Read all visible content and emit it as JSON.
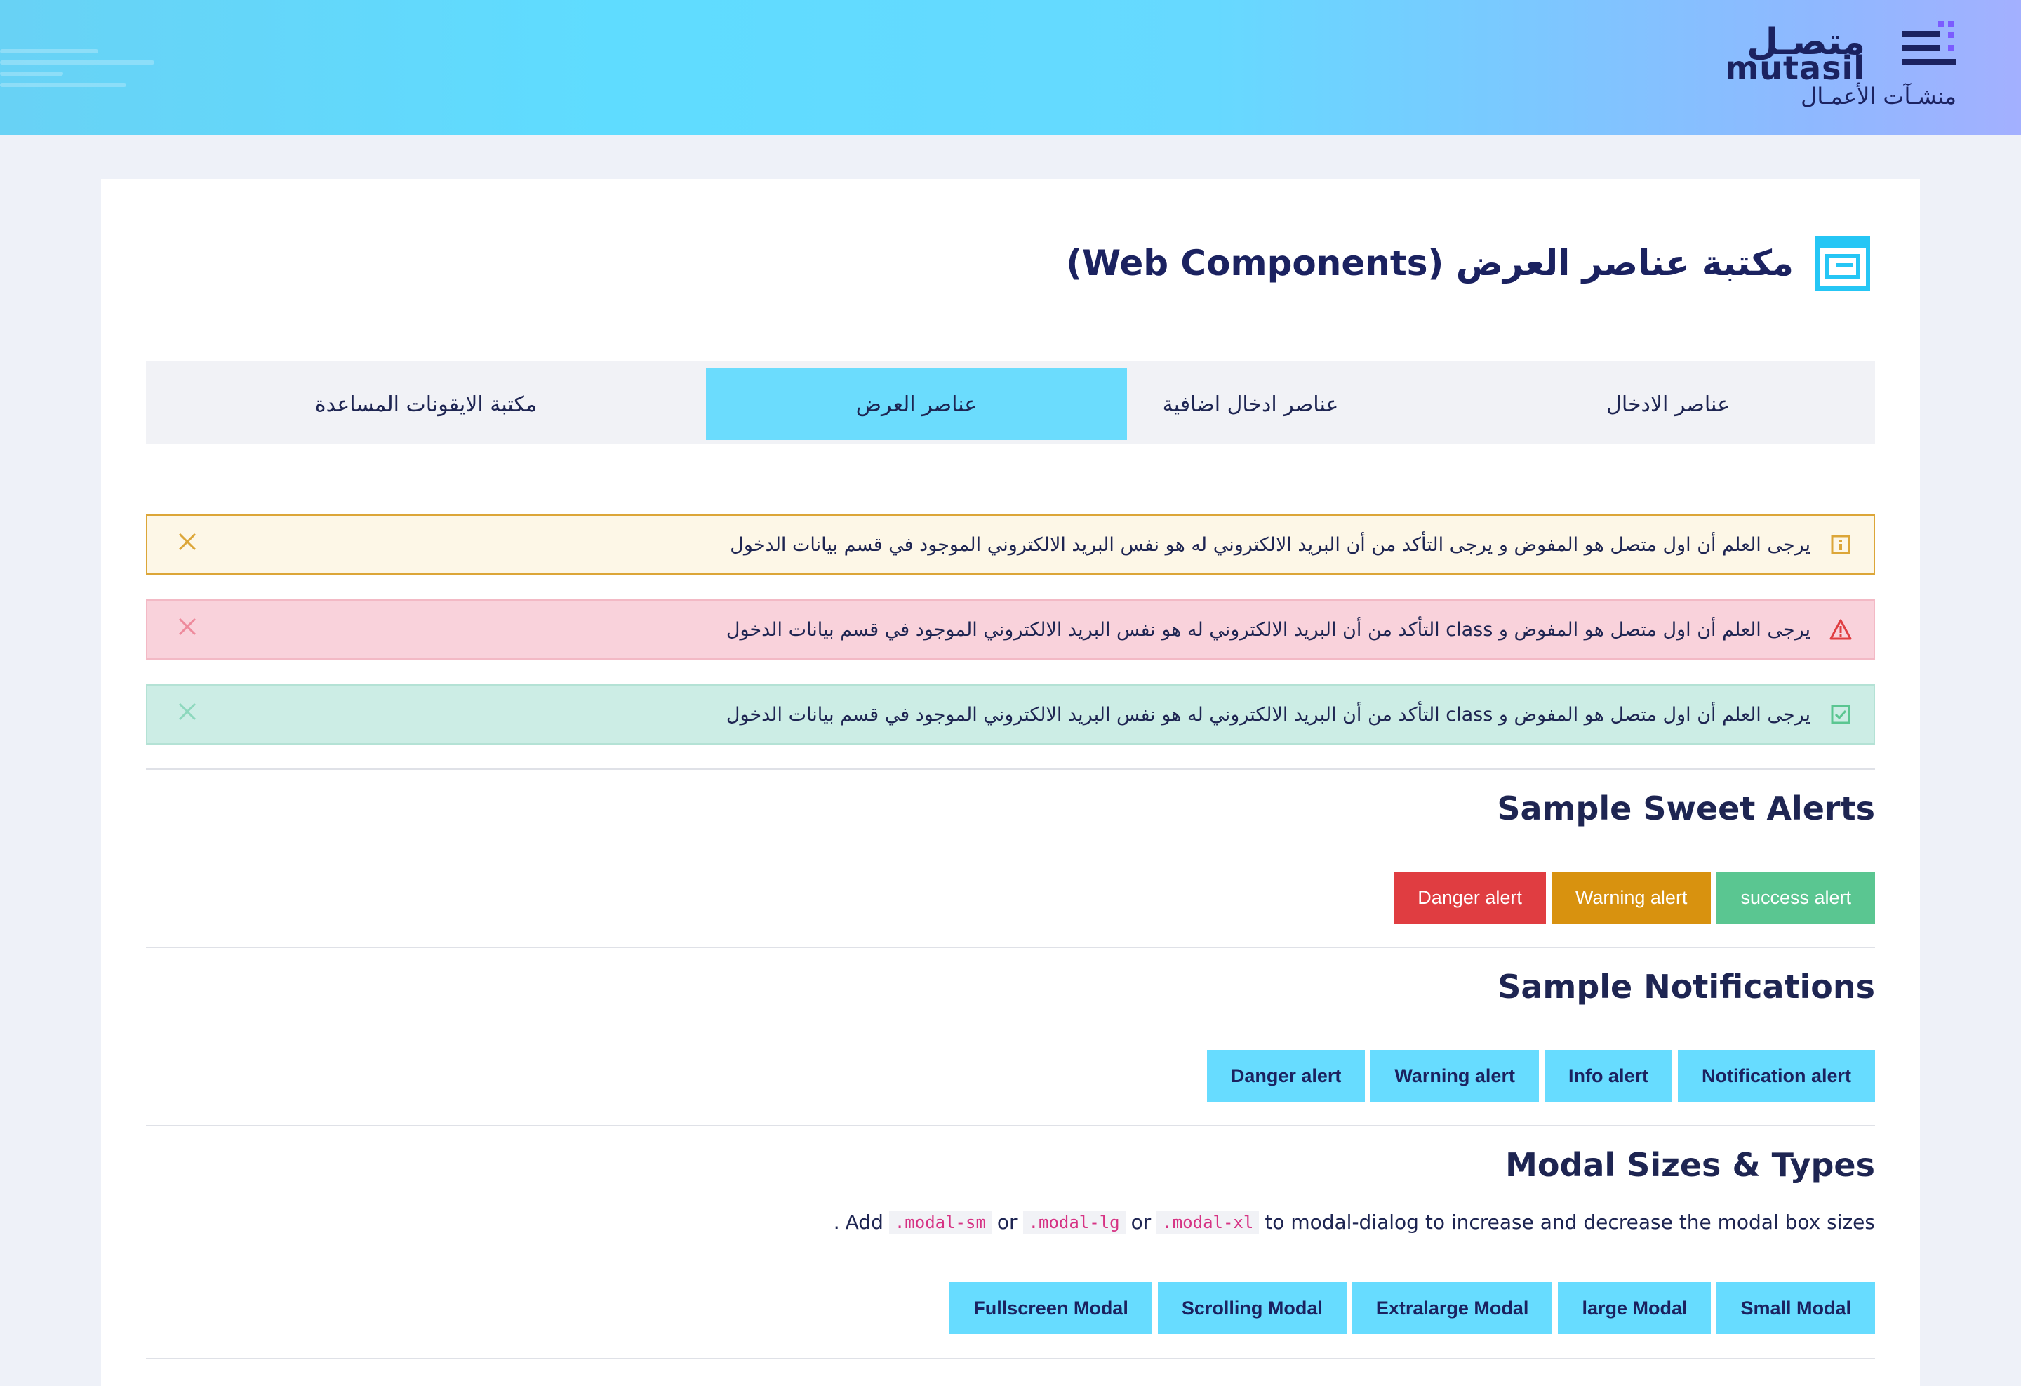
{
  "brand": {
    "logo_ar": "متصـل",
    "logo_en": "mutasil",
    "logo_sub": "منشـآت الأعمـال"
  },
  "page": {
    "title": "مكتبة عناصر العرض (Web Components)"
  },
  "tabs": [
    {
      "label": "عناصر الادخال"
    },
    {
      "label": "عناصر ادخال اضافية"
    },
    {
      "label": "عناصر العرض"
    },
    {
      "label": "مكتبة الايقونات المساعدة"
    }
  ],
  "alerts": {
    "warning": "يرجى العلم أن اول متصل هو المفوض و يرجى التأكد من أن البريد الالكتروني له هو نفس البريد الالكتروني الموجود في قسم بيانات الدخول",
    "danger": "يرجى العلم أن اول متصل هو المفوض و class التأكد من أن البريد الالكتروني له هو نفس البريد الالكتروني الموجود في قسم بيانات الدخول",
    "success": "يرجى العلم أن اول متصل هو المفوض و class التأكد من أن البريد الالكتروني له هو نفس البريد الالكتروني الموجود في قسم بيانات الدخول"
  },
  "sweet": {
    "title": "Sample Sweet Alerts",
    "success": "success alert",
    "warning": "Warning alert",
    "danger": "Danger alert"
  },
  "notifications": {
    "title": "Sample Notifications",
    "notification": "Notification alert",
    "info": "Info alert",
    "warning": "Warning alert",
    "danger": "Danger alert"
  },
  "modals": {
    "title": "Modal Sizes & Types",
    "note_prefix": "Add",
    "code_sm": ".modal-sm",
    "or1": "or",
    "code_lg": ".modal-lg",
    "or2": "or",
    "code_xl": ".modal-xl",
    "note_suffix": "to modal-dialog to increase and decrease the modal box sizes",
    "note_end": ".",
    "small": "Small Modal",
    "large": "large Modal",
    "extralarge": "Extralarge Modal",
    "scrolling": "Scrolling Modal",
    "fullscreen": "Fullscreen Modal"
  },
  "colors": {
    "accent": "#67dcff",
    "success": "#5ac691",
    "warning": "#d8920f",
    "danger": "#e03d41",
    "navy": "#1b2260"
  }
}
